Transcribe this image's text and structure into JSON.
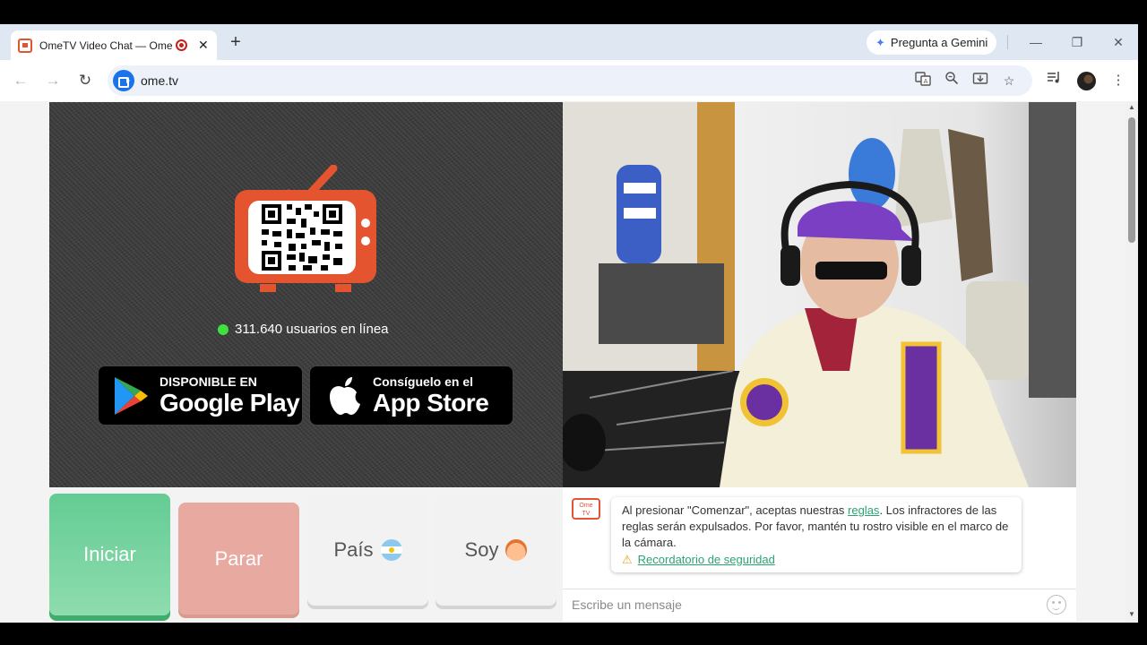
{
  "browser": {
    "tab_title": "OmeTV Video Chat — Ome",
    "gemini_label": "Pregunta a Gemini",
    "url": "ome.tv"
  },
  "hero": {
    "online_text": "311.640 usuarios en línea",
    "google_play": {
      "small": "DISPONIBLE EN",
      "big": "Google Play"
    },
    "app_store": {
      "small": "Consíguelo en el",
      "big": "App Store"
    }
  },
  "controls": {
    "start": "Iniciar",
    "stop": "Parar",
    "country": "País",
    "soy": "Soy"
  },
  "chat": {
    "logo_text_1": "Ome",
    "logo_text_2": "TV",
    "notice_before": "Al presionar \"Comenzar\", aceptas nuestras ",
    "rules_link": "reglas",
    "notice_after": ". Los infractores de las reglas serán expulsados. Por favor, mantén tu rostro visible en el marco de la cámara.",
    "safety_link": "Recordatorio de seguridad",
    "input_placeholder": "Escribe un mensaje"
  },
  "colors": {
    "start_green": "#63cc93",
    "stop_red": "#e8aaa0",
    "brand_orange": "#e4542f",
    "online_dot": "#3fe13f",
    "link_green": "#2aa373"
  }
}
